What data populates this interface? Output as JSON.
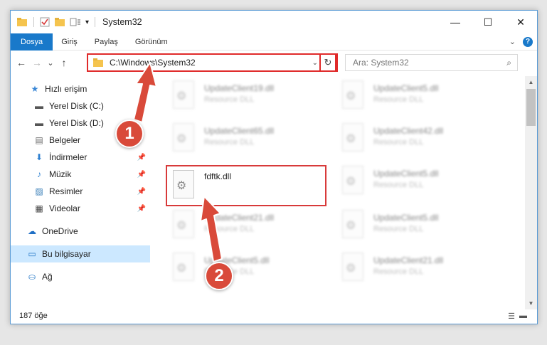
{
  "window": {
    "title": "System32",
    "controls": {
      "minimize": "—",
      "maximize": "☐",
      "close": "✕"
    }
  },
  "ribbon": {
    "tabs": [
      "Dosya",
      "Giriş",
      "Paylaş",
      "Görünüm"
    ],
    "expand_icon": "chevron-down-icon",
    "help_label": "?"
  },
  "nav": {
    "back": "←",
    "forward": "→",
    "recent": "⌄",
    "up": "↑"
  },
  "address": {
    "path": "C:\\Windows\\System32",
    "dropdown": "⌄",
    "refresh": "↻"
  },
  "search": {
    "placeholder": "Ara: System32",
    "icon": "⌕"
  },
  "sidebar": {
    "items": [
      {
        "label": "Hızlı erişim",
        "icon": "★"
      },
      {
        "label": "Yerel Disk (C:)",
        "icon": "▬"
      },
      {
        "label": "Yerel Disk (D:)",
        "icon": "▬"
      },
      {
        "label": "Belgeler",
        "icon": "▤"
      },
      {
        "label": "İndirmeler",
        "icon": "⬇"
      },
      {
        "label": "Müzik",
        "icon": "♪"
      },
      {
        "label": "Resimler",
        "icon": "▨"
      },
      {
        "label": "Videolar",
        "icon": "▦"
      },
      {
        "label": "OneDrive",
        "icon": "☁"
      },
      {
        "label": "Bu bilgisayar",
        "icon": "▭"
      },
      {
        "label": "Ağ",
        "icon": "⛀"
      }
    ]
  },
  "files": [
    {
      "name": "UpdateClient19.dll",
      "desc": "Resource DLL"
    },
    {
      "name": "UpdateClient5.dll",
      "desc": "Resource DLL"
    },
    {
      "name": "UpdateClient65.dll",
      "desc": "Resource DLL"
    },
    {
      "name": "UpdateClient42.dll",
      "desc": "Resource DLL"
    },
    {
      "name": "fdftk.dll",
      "desc": ""
    },
    {
      "name": "UpdateClient5.dll",
      "desc": "Resource DLL"
    },
    {
      "name": "UpdateClient21.dll",
      "desc": "Resource DLL"
    },
    {
      "name": "UpdateClient5.dll",
      "desc": "Resource DLL"
    },
    {
      "name": "UpdateClient5.dll",
      "desc": "Resource DLL"
    },
    {
      "name": "UpdateClient21.dll",
      "desc": "Resource DLL"
    }
  ],
  "status": {
    "count": "187 öğe"
  },
  "annotations": {
    "marker1": "1",
    "marker2": "2"
  },
  "colors": {
    "accent": "#1979ca",
    "highlight": "#e02a2a",
    "marker": "#d94a3a"
  }
}
